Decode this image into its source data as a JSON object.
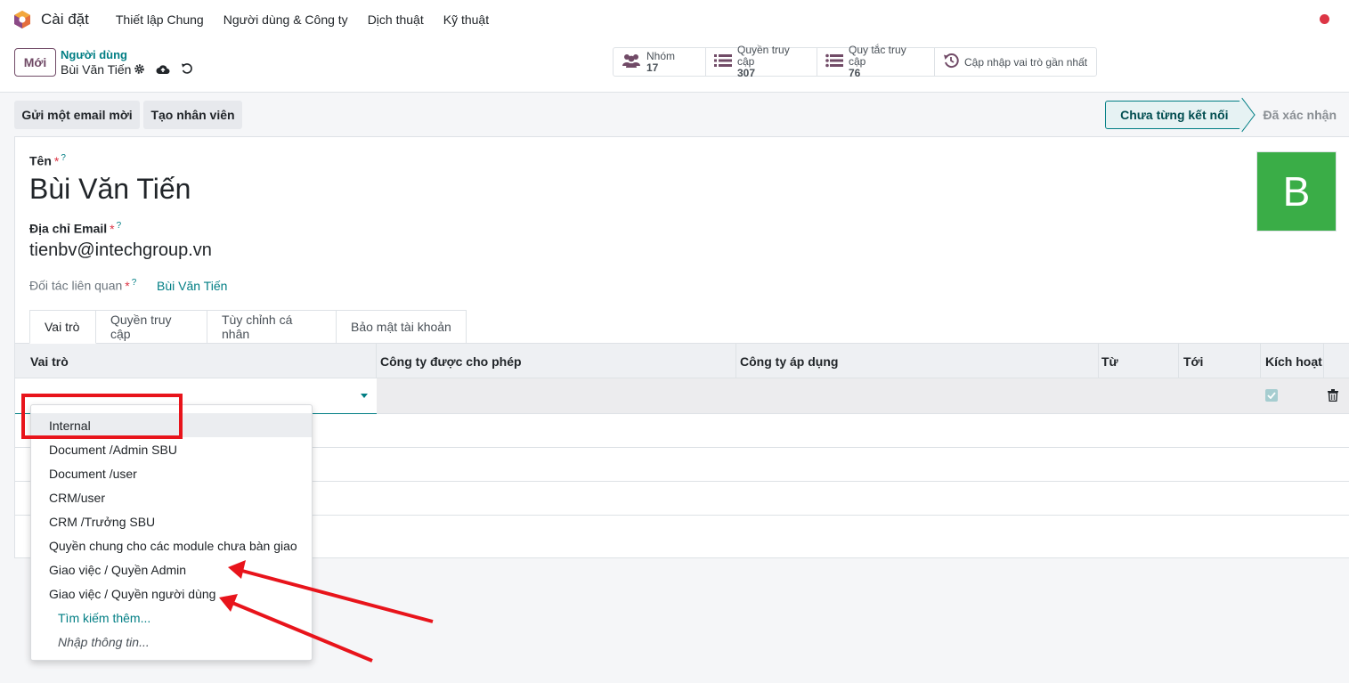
{
  "navbar": {
    "app_title": "Cài đặt",
    "menu": [
      "Thiết lập Chung",
      "Người dùng & Công ty",
      "Dịch thuật",
      "Kỹ thuật"
    ]
  },
  "control": {
    "new_label": "Mới",
    "breadcrumb_parent": "Người dùng",
    "breadcrumb_current": "Bùi Văn Tiến",
    "smart_buttons": {
      "groups": {
        "label": "Nhóm",
        "value": "17"
      },
      "access": {
        "label": "Quyền truy cập",
        "value": "307"
      },
      "rules": {
        "label": "Quy tắc truy cập",
        "value": "76"
      },
      "update": {
        "label": "Cập nhập vai trò gần nhất"
      }
    }
  },
  "actions": {
    "send_email": "Gửi một email mời",
    "create_employee": "Tạo nhân viên"
  },
  "status": {
    "current": "Chưa từng kết nối",
    "next": "Đã xác nhận"
  },
  "form": {
    "name_label": "Tên",
    "name_value": "Bùi Văn Tiến",
    "email_label": "Địa chỉ Email",
    "email_value": "tienbv@intechgroup.vn",
    "partner_label": "Đối tác liên quan",
    "partner_value": "Bùi Văn Tiến",
    "required_mark": "*",
    "help_mark": "?",
    "avatar_letter": "B"
  },
  "tabs": [
    "Vai trò",
    "Quyền truy cập",
    "Tùy chỉnh cá nhân",
    "Bảo mật tài khoản"
  ],
  "table": {
    "columns": [
      "Vai trò",
      "Công ty được cho phép",
      "Công ty áp dụng",
      "Từ",
      "Tới",
      "Kích hoạt"
    ]
  },
  "dropdown": {
    "items": [
      "Internal",
      "Document /Admin SBU",
      "Document /user",
      "CRM/user",
      "CRM /Trưởng SBU",
      "Quyền chung cho các module chưa bàn giao",
      "Giao việc / Quyền Admin",
      "Giao việc / Quyền người dùng"
    ],
    "search_more": "Tìm kiếm thêm...",
    "create_edit": "Nhập thông tin..."
  },
  "colors": {
    "accent": "#017e84",
    "brand": "#714b67",
    "annotation": "#e8141b",
    "avatar": "#3aad47"
  }
}
